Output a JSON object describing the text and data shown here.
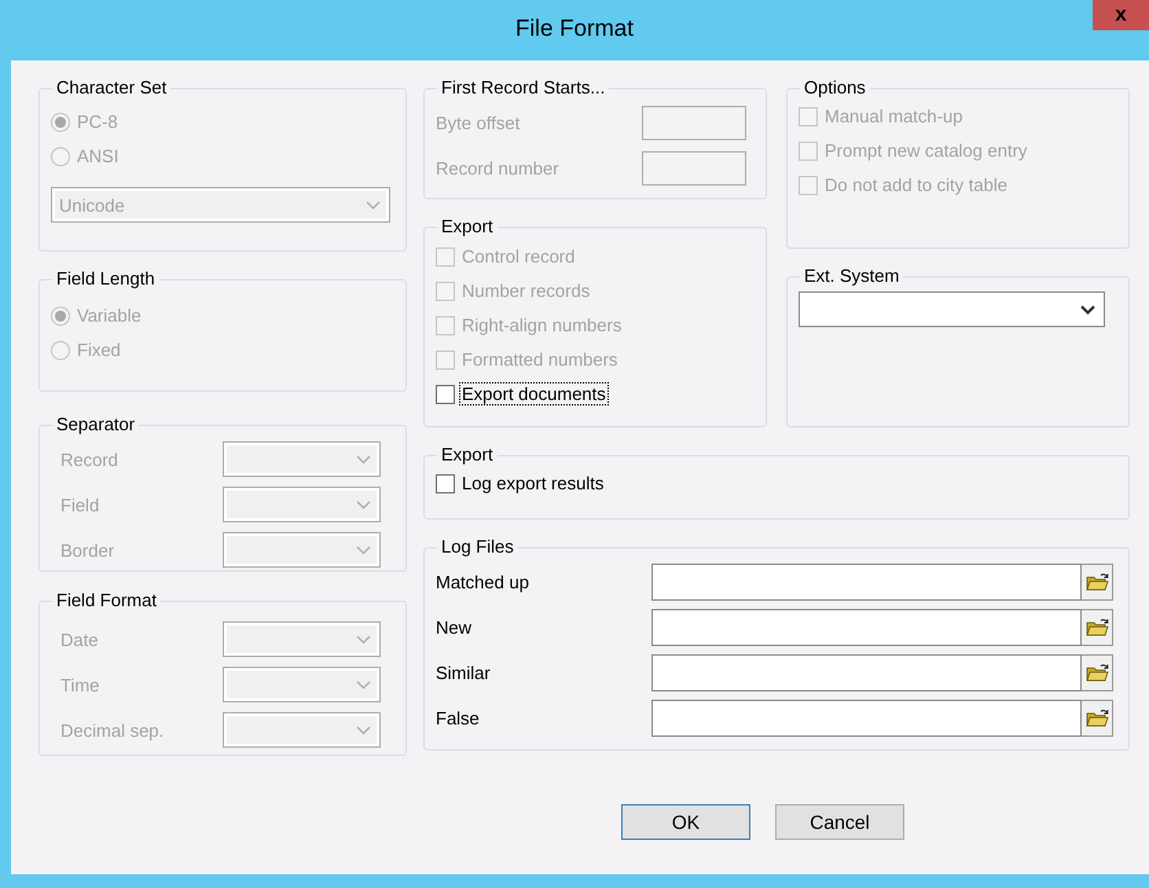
{
  "window": {
    "title": "File Format",
    "close": "x"
  },
  "character_set": {
    "label": "Character Set",
    "options": [
      {
        "label": "PC-8",
        "selected": true,
        "disabled": true
      },
      {
        "label": "ANSI",
        "selected": false,
        "disabled": true
      }
    ],
    "dropdown": {
      "value": "Unicode",
      "disabled": true
    }
  },
  "field_length": {
    "label": "Field Length",
    "options": [
      {
        "label": "Variable",
        "selected": true,
        "disabled": true
      },
      {
        "label": "Fixed",
        "selected": false,
        "disabled": true
      }
    ]
  },
  "separator": {
    "label": "Separator",
    "fields": [
      {
        "label": "Record",
        "disabled": true
      },
      {
        "label": "Field",
        "disabled": true
      },
      {
        "label": "Border",
        "disabled": true
      }
    ]
  },
  "field_format": {
    "label": "Field Format",
    "fields": [
      {
        "label": "Date",
        "disabled": true
      },
      {
        "label": "Time",
        "disabled": true
      },
      {
        "label": "Decimal sep.",
        "disabled": true
      }
    ]
  },
  "first_record_starts": {
    "label": "First Record Starts...",
    "fields": [
      {
        "label": "Byte offset",
        "disabled": true
      },
      {
        "label": "Record number",
        "disabled": true
      }
    ]
  },
  "export": {
    "label": "Export",
    "options": [
      {
        "label": "Control record",
        "checked": false,
        "disabled": true,
        "focused": false
      },
      {
        "label": "Number records",
        "checked": false,
        "disabled": true,
        "focused": false
      },
      {
        "label": "Right-align numbers",
        "checked": false,
        "disabled": true,
        "focused": false
      },
      {
        "label": "Formatted numbers",
        "checked": false,
        "disabled": true,
        "focused": false
      },
      {
        "label": "Export documents",
        "checked": false,
        "disabled": false,
        "focused": true
      }
    ]
  },
  "options": {
    "label": "Options",
    "options": [
      {
        "label": "Manual match-up",
        "checked": false,
        "disabled": true,
        "focused": false
      },
      {
        "label": "Prompt new catalog entry",
        "checked": false,
        "disabled": true,
        "focused": false
      },
      {
        "label": "Do not add to city table",
        "checked": false,
        "disabled": true,
        "focused": false
      }
    ]
  },
  "ext_system": {
    "label": "Ext. System",
    "dropdown": {
      "disabled": false
    }
  },
  "export_log": {
    "label": "Export",
    "options": [
      {
        "label": "Log export results",
        "checked": false,
        "disabled": false,
        "focused": false
      }
    ]
  },
  "log_files": {
    "label": "Log Files",
    "fields": [
      {
        "label": "Matched up"
      },
      {
        "label": "New"
      },
      {
        "label": "Similar"
      },
      {
        "label": "False"
      }
    ]
  },
  "buttons": [
    {
      "label": "OK",
      "default": true
    },
    {
      "label": "Cancel",
      "default": false
    }
  ]
}
